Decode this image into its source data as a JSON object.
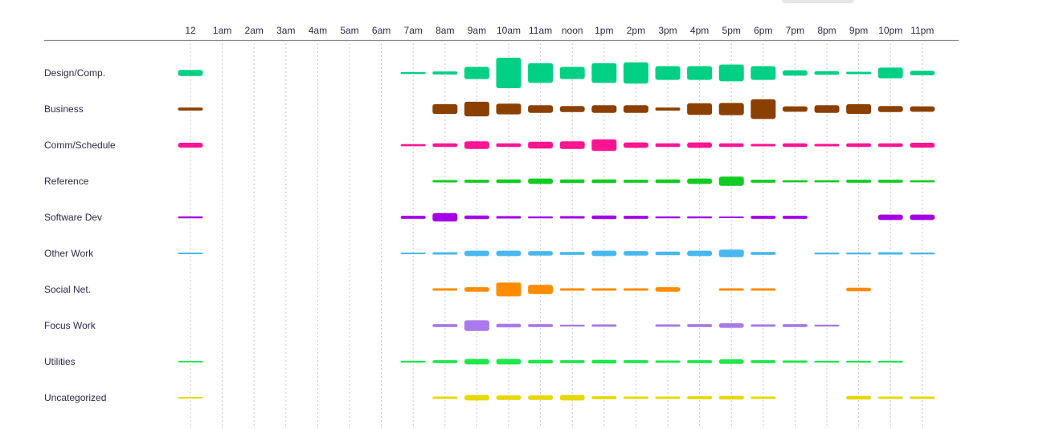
{
  "chart_data": {
    "type": "heatmap",
    "x": [
      "12",
      "1am",
      "2am",
      "3am",
      "4am",
      "5am",
      "6am",
      "7am",
      "8am",
      "9am",
      "10am",
      "11am",
      "noon",
      "1pm",
      "2pm",
      "3pm",
      "4pm",
      "5pm",
      "6pm",
      "7pm",
      "8pm",
      "9pm",
      "10pm",
      "11pm"
    ],
    "y": [
      "Design/Comp.",
      "Business",
      "Comm/Schedule",
      "Reference",
      "Software Dev",
      "Other Work",
      "Social Net.",
      "Focus Work",
      "Utilities",
      "Uncategorized"
    ],
    "colors": [
      "#00d084",
      "#8b4000",
      "#ff1493",
      "#11cc22",
      "#a300e6",
      "#4ab8f0",
      "#ff8c00",
      "#a97aeb",
      "#1ee84a",
      "#e6d800"
    ],
    "max_value": 10,
    "values": [
      [
        2,
        0,
        0,
        0,
        0,
        0,
        0,
        0.6,
        1,
        4,
        10,
        6.5,
        4,
        6.5,
        7,
        4.5,
        4.5,
        5.5,
        4.5,
        1.8,
        1.2,
        0.8,
        3.5,
        1.5
      ],
      [
        1,
        0,
        0,
        0,
        0,
        0,
        0,
        0,
        3.2,
        4.8,
        3.5,
        2.5,
        2,
        2.5,
        2.5,
        1,
        3.8,
        4,
        6.5,
        1.8,
        2.5,
        3.2,
        2,
        1.8
      ],
      [
        1.6,
        0,
        0,
        0,
        0,
        0,
        0,
        0.7,
        1.2,
        2.5,
        1.2,
        2.2,
        2.5,
        3.8,
        1.8,
        1.2,
        1.8,
        1.2,
        0.8,
        1.2,
        0.8,
        1.2,
        1.2,
        1.6
      ],
      [
        0,
        0,
        0,
        0,
        0,
        0,
        0,
        0,
        0.8,
        1,
        1.2,
        1.8,
        1.2,
        1.2,
        1,
        1.2,
        1.8,
        3,
        1,
        0.7,
        0.7,
        1,
        1,
        0.7
      ],
      [
        0.6,
        0,
        0,
        0,
        0,
        0,
        0,
        1,
        2.8,
        1.2,
        0.8,
        0.6,
        0.8,
        1.2,
        1,
        0.6,
        0.6,
        0.4,
        1,
        1,
        0,
        0,
        1.8,
        1.8
      ],
      [
        0.5,
        0,
        0,
        0,
        0,
        0,
        0,
        0.5,
        0.8,
        1.8,
        1.8,
        1.5,
        1,
        1.8,
        1.5,
        1.2,
        1.8,
        2.5,
        1,
        0,
        0.6,
        0.6,
        0.8,
        0.6
      ],
      [
        0,
        0,
        0,
        0,
        0,
        0,
        0,
        0,
        0.8,
        1.5,
        4.5,
        3,
        0.8,
        0.8,
        0.8,
        1.5,
        0,
        0.8,
        0.8,
        0,
        0,
        1.2,
        0,
        0
      ],
      [
        0,
        0,
        0,
        0,
        0,
        0,
        0,
        0,
        1,
        3.5,
        1.2,
        1,
        0.6,
        0.8,
        0,
        0.8,
        1,
        1.5,
        0.8,
        1,
        0.6,
        0,
        0,
        0
      ],
      [
        0.3,
        0,
        0,
        0,
        0,
        0,
        0,
        0.6,
        1,
        1.8,
        1.8,
        1.2,
        1,
        1.2,
        1,
        0.8,
        1,
        1.5,
        1,
        0.8,
        0.6,
        0.6,
        0.6,
        0
      ],
      [
        0.5,
        0,
        0,
        0,
        0,
        0,
        0,
        0,
        0.8,
        1.8,
        1.5,
        1.5,
        1.8,
        1,
        0.8,
        0.8,
        1,
        1.2,
        0.8,
        0,
        0,
        1.2,
        0.8,
        0.8
      ]
    ],
    "grid": "dotted vertical lines at each hour",
    "legend": "none"
  }
}
